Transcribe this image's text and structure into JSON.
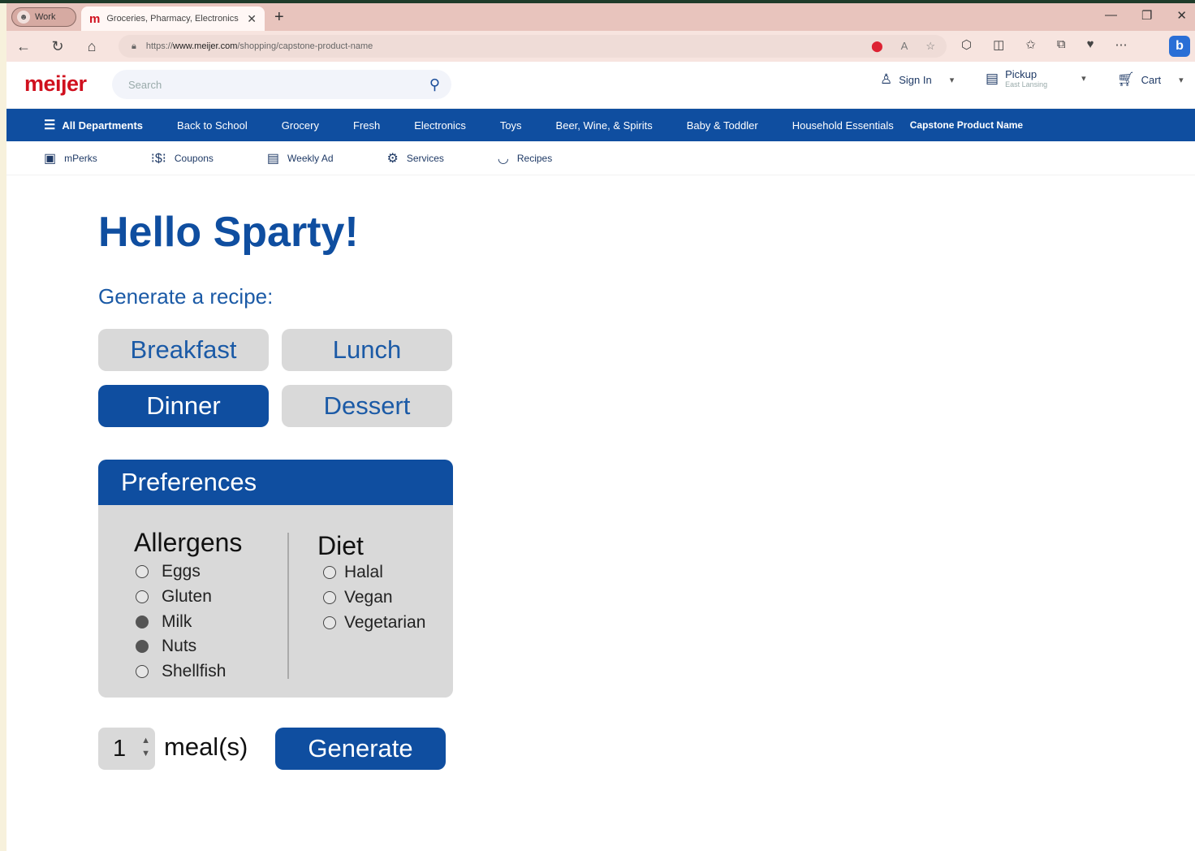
{
  "browser": {
    "profile_label": "Work",
    "tab_title": "Groceries, Pharmacy, Electronics",
    "url_prefix": "https://",
    "url_domain": "www.meijer.com",
    "url_path": "/shopping/capstone-product-name"
  },
  "site": {
    "logo": "meijer",
    "search_placeholder": "Search",
    "sign_in": "Sign In",
    "pickup": "Pickup",
    "pickup_location": "East Lansing",
    "cart": "Cart"
  },
  "nav": {
    "all_departments": "All Departments",
    "items": [
      "Back to School",
      "Grocery",
      "Fresh",
      "Electronics",
      "Toys",
      "Beer, Wine, & Spirits",
      "Baby & Toddler",
      "Household Essentials"
    ],
    "capstone": "Capstone Product Name"
  },
  "subnav": [
    "mPerks",
    "Coupons",
    "Weekly Ad",
    "Services",
    "Recipes"
  ],
  "main": {
    "greeting": "Hello Sparty!",
    "generate_label": "Generate a recipe:",
    "meals": [
      "Breakfast",
      "Lunch",
      "Dinner",
      "Dessert"
    ],
    "selected_meal": "Dinner",
    "preferences_title": "Preferences",
    "allergens_title": "Allergens",
    "allergens": [
      "Eggs",
      "Gluten",
      "Milk",
      "Nuts",
      "Shellfish"
    ],
    "allergens_checked": [
      "Milk",
      "Nuts"
    ],
    "diet_title": "Diet",
    "diets": [
      "Halal",
      "Vegan",
      "Vegetarian"
    ],
    "meal_count": "1",
    "meal_count_label": "meal(s)",
    "generate_button": "Generate"
  },
  "colors": {
    "brand_blue": "#0f4ea0",
    "brand_red": "#d0101e",
    "button_gray": "#d9d9d9"
  }
}
